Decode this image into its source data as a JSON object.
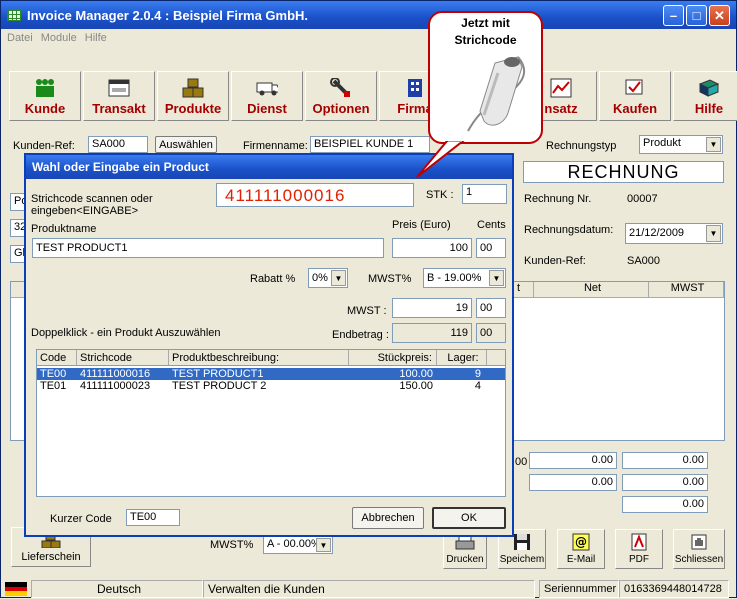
{
  "window": {
    "title": "Invoice Manager 2.0.4 : Beispiel Firma GmbH."
  },
  "menu": [
    "Datei",
    "Module",
    "Hilfe"
  ],
  "toolbar": [
    {
      "label": "Kunde",
      "icon": "people-icon"
    },
    {
      "label": "Transakt",
      "icon": "window-icon"
    },
    {
      "label": "Produkte",
      "icon": "boxes-icon"
    },
    {
      "label": "Dienst",
      "icon": "van-icon"
    },
    {
      "label": "Optionen",
      "icon": "wrench-icon"
    },
    {
      "label": "Firma",
      "icon": "building-icon"
    },
    {
      "label": "",
      "icon": ""
    },
    {
      "label": "nsatz",
      "icon": "chart-icon"
    },
    {
      "label": "Kaufen",
      "icon": "cart-icon"
    },
    {
      "label": "Hilfe",
      "icon": "book-icon"
    }
  ],
  "callout": {
    "line1": "Jetzt mit",
    "line2": "Strichcode"
  },
  "main": {
    "kunden_ref_label": "Kunden-Ref:",
    "kunden_ref": "SA000",
    "auswahlen": "Auswählen",
    "firmenname_label": "Firmenname:",
    "firmenname": "BEISPIEL KUNDE 1",
    "rechnungstyp_label": "Rechnungstyp",
    "rechnungstyp": "Produkt",
    "rechnung_title": "RECHNUNG",
    "rechnung_nr_label": "Rechnung Nr.",
    "rechnung_nr": "00007",
    "rechnungsdatum_label": "Rechnungsdatum:",
    "rechnungsdatum": "21/12/2009",
    "kunden_ref2_label": "Kunden-Ref:",
    "kunden_ref2": "SA000",
    "left_partial": [
      "Po",
      "32",
      "Gl"
    ],
    "grid_headers": [
      "t",
      "Net",
      "MWST"
    ],
    "totals": [
      {
        "a": "00",
        "b": "0.00",
        "c": "0.00"
      },
      {
        "b": "0.00",
        "c": "0.00"
      },
      {
        "c": "0.00"
      }
    ],
    "mwst_label": "MWST%",
    "mwst_combo": "A - 00.00%",
    "lieferschein": "Lieferschein",
    "bottom_buttons": [
      {
        "label": "Drucken",
        "icon": "printer-icon"
      },
      {
        "label": "Speichem",
        "icon": "floppy-icon"
      },
      {
        "label": "E-Mail",
        "icon": "email-icon"
      },
      {
        "label": "PDF",
        "icon": "pdf-icon"
      },
      {
        "label": "Schliessen",
        "icon": "hand-icon"
      }
    ]
  },
  "dialog": {
    "title": "Wahl oder Eingabe ein Product",
    "barcode_label1": "Strichcode scannen oder",
    "barcode_label2": "eingeben<EINGABE>",
    "barcode": "411111000016",
    "stk_label": "STK :",
    "stk": "1",
    "produktname_label": "Produktname",
    "preis_label": "Preis (Euro)",
    "cents_label": "Cents",
    "produktname": "TEST PRODUCT1",
    "preis": "100",
    "preis_cents": "00",
    "rabatt_label": "Rabatt %",
    "rabatt": "0%",
    "mwst_label": "MWST%",
    "mwst_combo": "B - 19.00%",
    "mwst_amount_label": "MWST :",
    "mwst_amount": "19",
    "mwst_cents": "00",
    "hint": "Doppelklick - ein Produkt Auszuwählen",
    "endbetrag_label": "Endbetrag :",
    "endbetrag": "119",
    "endbetrag_cents": "00",
    "columns": [
      "Code",
      "Strichcode",
      "Produktbeschreibung:",
      "Stückpreis:",
      "Lager:"
    ],
    "rows": [
      {
        "code": "TE00",
        "barcode": "411111000016",
        "desc": "TEST PRODUCT1",
        "price": "100.00",
        "stock": "9"
      },
      {
        "code": "TE01",
        "barcode": "411111000023",
        "desc": "TEST PRODUCT 2",
        "price": "150.00",
        "stock": "4"
      }
    ],
    "kurzer_label": "Kurzer Code",
    "kurzer": "TE00",
    "abbrechen": "Abbrechen",
    "ok": "OK"
  },
  "statusbar": {
    "language": "Deutsch",
    "message": "Verwalten die Kunden",
    "serial_label": "Seriennummer",
    "serial": "0163369448014728"
  }
}
